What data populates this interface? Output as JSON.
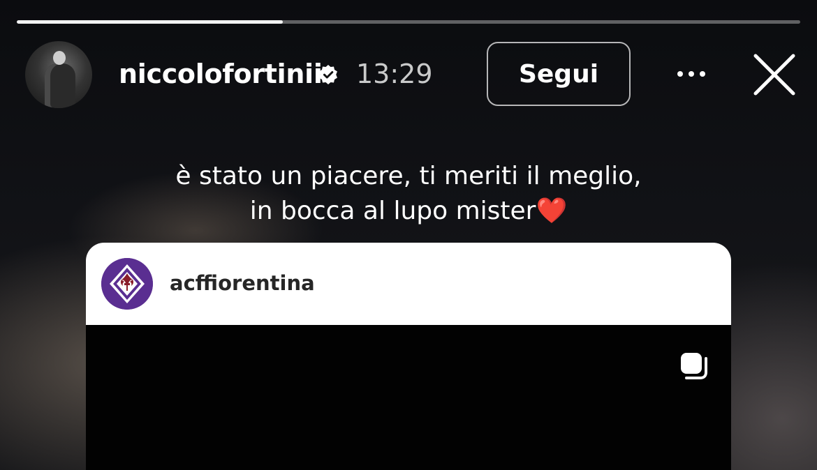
{
  "story": {
    "progress": 0.34,
    "username": "niccolofortinii",
    "time": "13:29",
    "follow_label": "Segui",
    "icons": {
      "verified": "verified-badge-icon",
      "more": "more-options-icon",
      "close": "close-icon",
      "carousel": "carousel-icon"
    }
  },
  "caption": {
    "line1": "è stato un piacere, ti meriti il meglio,",
    "line2": "in bocca al lupo mister",
    "emoji": "❤️"
  },
  "reshared_post": {
    "username": "acffiorentina",
    "avatar_color": "#5a2e91"
  }
}
